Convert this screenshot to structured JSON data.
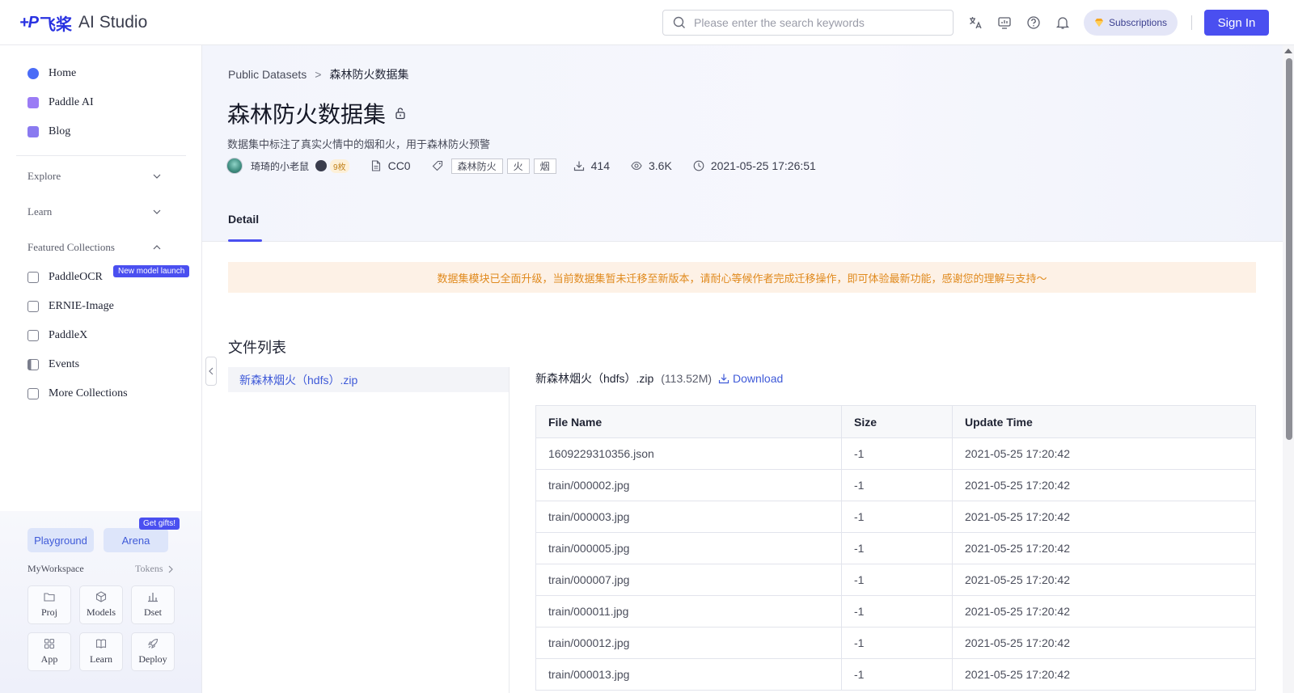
{
  "header": {
    "logo_mark": "+P",
    "logo_cn": "飞桨",
    "logo_text": "AI Studio",
    "search_placeholder": "Please enter the search keywords",
    "subscriptions_label": "Subscriptions",
    "sign_in_label": "Sign In",
    "icons": [
      "translate-icon",
      "monitor-icon",
      "help-icon",
      "bell-icon"
    ]
  },
  "sidebar": {
    "primary": [
      {
        "label": "Home",
        "icon": "planet-icon",
        "color": "#4a6cf7"
      },
      {
        "label": "Paddle AI",
        "icon": "robot-icon",
        "color": "#9b7cf5"
      },
      {
        "label": "Blog",
        "icon": "blog-icon",
        "color": "#8a7af0"
      }
    ],
    "groups": [
      {
        "label": "Explore",
        "expanded": false
      },
      {
        "label": "Learn",
        "expanded": false
      },
      {
        "label": "Featured Collections",
        "expanded": true
      }
    ],
    "collections": [
      {
        "label": "PaddleOCR",
        "icon": "ocr-icon"
      },
      {
        "label": "ERNIE-Image",
        "icon": "image-icon"
      },
      {
        "label": "PaddleX",
        "icon": "paddlex-icon"
      },
      {
        "label": "Events",
        "icon": "flag-icon"
      },
      {
        "label": "More Collections",
        "icon": "collection-icon"
      }
    ],
    "new_badge": "New model launch",
    "playground_label": "Playground",
    "arena_label": "Arena",
    "gift_badge": "Get gifts!",
    "workspace_label": "MyWorkspace",
    "tokens_label": "Tokens",
    "tiles": [
      {
        "label": "Proj",
        "icon": "folder-icon"
      },
      {
        "label": "Models",
        "icon": "cube-icon"
      },
      {
        "label": "Dset",
        "icon": "bar-chart-icon"
      },
      {
        "label": "App",
        "icon": "grid-icon"
      },
      {
        "label": "Learn",
        "icon": "book-icon"
      },
      {
        "label": "Deploy",
        "icon": "rocket-icon"
      }
    ]
  },
  "main": {
    "breadcrumb": {
      "parent": "Public Datasets",
      "separator": ">",
      "current": "森林防火数据集"
    },
    "title": "森林防火数据集",
    "description": "数据集中标注了真实火情中的烟和火，用于森林防火预警",
    "author": "琦琦的小老鼠",
    "coins": "9枚",
    "license": "CC0",
    "tags": [
      "森林防火",
      "火",
      "烟"
    ],
    "downloads": "414",
    "views": "3.6K",
    "created": "2021-05-25 17:26:51",
    "tab": "Detail",
    "notice": "数据集模块已全面升级，当前数据集暂未迁移至新版本，请耐心等候作者完成迁移操作，即可体验最新功能，感谢您的理解与支持～",
    "file_list_title": "文件列表",
    "files": [
      "新森林烟火（hdfs）.zip"
    ],
    "selected_file": {
      "name": "新森林烟火（hdfs）.zip",
      "size": "(113.52M)",
      "download_label": "Download"
    },
    "table": {
      "headers": [
        "File Name",
        "Size",
        "Update Time"
      ],
      "rows": [
        [
          "1609229310356.json",
          "-1",
          "2021-05-25 17:20:42"
        ],
        [
          "train/000002.jpg",
          "-1",
          "2021-05-25 17:20:42"
        ],
        [
          "train/000003.jpg",
          "-1",
          "2021-05-25 17:20:42"
        ],
        [
          "train/000005.jpg",
          "-1",
          "2021-05-25 17:20:42"
        ],
        [
          "train/000007.jpg",
          "-1",
          "2021-05-25 17:20:42"
        ],
        [
          "train/000011.jpg",
          "-1",
          "2021-05-25 17:20:42"
        ],
        [
          "train/000012.jpg",
          "-1",
          "2021-05-25 17:20:42"
        ],
        [
          "train/000013.jpg",
          "-1",
          "2021-05-25 17:20:42"
        ]
      ]
    }
  },
  "colors": {
    "brand": "#2932e1",
    "primary_button": "#4a4ff0",
    "notice_text": "#e08a1e",
    "link": "#3f5ad8"
  }
}
